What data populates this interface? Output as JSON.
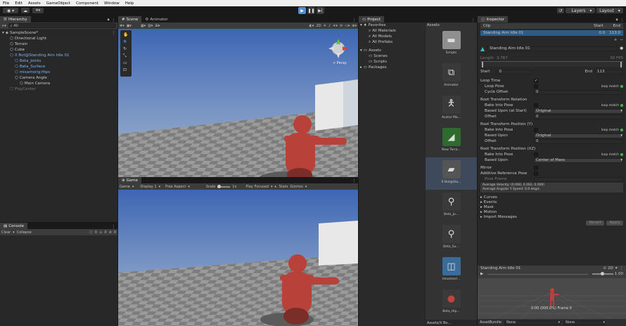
{
  "menu": [
    "File",
    "Edit",
    "Assets",
    "GameObject",
    "Component",
    "Window",
    "Help"
  ],
  "toolbar": {
    "layers": "Layers",
    "layout": "Layout"
  },
  "hierarchy": {
    "tab": "Hierarchy",
    "search": "All",
    "scene": "SampleScene*",
    "items": [
      {
        "label": "Directional Light",
        "indent": 2,
        "color": "normal"
      },
      {
        "label": "Terrain",
        "indent": 2,
        "color": "normal"
      },
      {
        "label": "Cube",
        "indent": 2,
        "color": "normal"
      },
      {
        "label": "X Bot@Standing Aim Idle 01",
        "indent": 2,
        "color": "blue"
      },
      {
        "label": "Beta_Joints",
        "indent": 3,
        "color": "blue"
      },
      {
        "label": "Beta_Surface",
        "indent": 3,
        "color": "blue"
      },
      {
        "label": "mixamorig:Hips",
        "indent": 3,
        "color": "blue"
      },
      {
        "label": "Camera Angle",
        "indent": 3,
        "color": "normal"
      },
      {
        "label": "Main Camera",
        "indent": 4,
        "color": "normal"
      },
      {
        "label": "PlayCenter",
        "indent": 2,
        "color": "dim"
      }
    ]
  },
  "console": {
    "tab": "Console",
    "clear": "Clear",
    "collapse": "Collapse",
    "counts": [
      "0",
      "0",
      "0"
    ]
  },
  "scene": {
    "tab": "Scene",
    "animator_tab": "Animator",
    "mode_2d": "2D",
    "persp": "< Persp"
  },
  "game": {
    "tab": "Game",
    "view": "Game",
    "display": "Display 1",
    "aspect": "Free Aspect",
    "scale_label": "Scale",
    "scale_value": "1x",
    "play_focused": "Play Focused",
    "stats": "Stats",
    "gizmos": "Gizmos"
  },
  "project": {
    "tab": "Project",
    "favorites": "Favorites",
    "fav_items": [
      "All Materials",
      "All Models",
      "All Prefabs"
    ],
    "assets": "Assets",
    "asset_items": [
      "Scenes",
      "Scripts"
    ],
    "packages": "Packages",
    "assets_header": "Assets",
    "grid_items": [
      "Scripts",
      "Animator",
      "Avatar Ma...",
      "New Terra...",
      "X Bot@Sta...",
      "Beta_Jo...",
      "Beta_Su...",
      "mixamori...",
      "Beta_Hip..."
    ],
    "path": "Assets/X Bo..."
  },
  "inspector": {
    "tab": "Inspector",
    "clip_header": "Clip",
    "start_header": "Start",
    "end_header": "End",
    "clip_name": "Standing Aim Idle 01",
    "clip_start": "0.0",
    "clip_end": "113.0",
    "title": "Standing Aim Idle 01",
    "length_label": "Length",
    "length_value": "3.767",
    "fps": "30 FPS",
    "start_label": "Start",
    "start_value": "0",
    "end_label": "End",
    "end_value": "113",
    "loop_time": "Loop Time",
    "loop_pose": "Loop Pose",
    "loop_match": "loop match",
    "cycle_offset": "Cycle Offset",
    "cycle_value": "0",
    "rot_header": "Root Transform Rotation",
    "bake_into_pose": "Bake Into Pose",
    "based_upon_start": "Based Upon (at Start)",
    "based_upon": "Based Upon",
    "original": "Original",
    "offset": "Offset",
    "offset_value": "0",
    "posy_header": "Root Transform Position (Y)",
    "posxz_header": "Root Transform Position (XZ)",
    "center_of_mass": "Center of Mass",
    "mirror": "Mirror",
    "additive": "Additive Reference Pose",
    "pose_frame": "Pose Frame",
    "avg_velocity": "Average Velocity: (0.000, 0.002, 0.000)",
    "avg_angular": "Average Angular Y Speed: 0.0 deg/s",
    "foldouts": [
      "Curves",
      "Events",
      "Mask",
      "Motion",
      "Import Messages"
    ],
    "revert": "Revert",
    "apply": "Apply",
    "preview_title": "Standing Aim Idle 01",
    "preview_speed": "2D",
    "preview_speed_value": "1.00",
    "preview_time": "0:00 (000.0%) Frame 0",
    "asset_bundle": "AssetBundle",
    "bundle_none": "None",
    "bundle_none2": "None"
  },
  "colors": {
    "accent": "#4c8fd6",
    "floor": "#8a8a8a",
    "sky": "#3d66b3",
    "character": "#b8423a"
  }
}
